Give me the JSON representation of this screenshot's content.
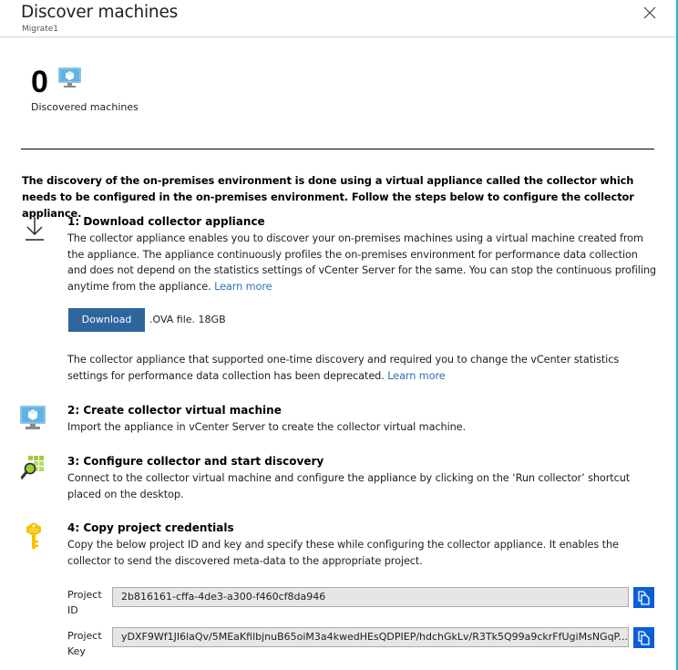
{
  "header": {
    "title": "Discover machines",
    "subtitle": "Migrate1",
    "close_icon": "close-icon"
  },
  "summary": {
    "count": "0",
    "icon": "virtual-machine-icon",
    "label": "Discovered machines"
  },
  "intro": "The discovery of the on-premises environment is done using a virtual appliance called the collector which needs to be configured in the on-premises environment. Follow the steps below to configure the collector appliance.",
  "steps": [
    {
      "icon": "download-icon",
      "title": "1: Download collector appliance",
      "body": "The collector appliance enables you to discover your on-premises machines using a virtual machine created from the appliance. The appliance continuously profiles the on-premises environment for performance data collection and does not depend on the statistics settings of vCenter Server for the same. You can stop the continuous profiling anytime from the appliance.",
      "link": "Learn more",
      "download_label": "Download",
      "download_info": ".OVA file. 18GB",
      "deprecated_text": "The collector appliance that supported one-time discovery and required you to change the vCenter statistics settings for performance data collection has been deprecated.",
      "deprecated_link": "Learn more"
    },
    {
      "icon": "virtual-machine-icon",
      "title": "2: Create collector virtual machine",
      "body": "Import the appliance in vCenter Server to create the collector virtual machine."
    },
    {
      "icon": "discovery-search-icon",
      "title": "3: Configure collector and start discovery",
      "body": "Connect to the collector virtual machine and configure the appliance by clicking on the ‘Run collector’ shortcut placed on the desktop."
    },
    {
      "icon": "key-icon",
      "title": "4: Copy project credentials",
      "body": "Copy the below project ID and key and specify these while configuring the collector appliance. It enables the collector to send the discovered meta-data to the appropriate project."
    }
  ],
  "credentials": {
    "project_id_label": "Project ID",
    "project_id_value": "2b816161-cffa-4de3-a300-f460cf8da946",
    "project_key_label": "Project Key",
    "project_key_value": "yDXF9Wf1JI6laQv/5MEaKfilbjnuB65oiM3a4kwedHEsQDPIEP/hdchGkLv/R3Tk5Q99a9ckrFfUgiMsNGqP...",
    "copy_icon": "copy-icon"
  },
  "colors": {
    "accent_button": "#2f659c",
    "copy_button": "#0a5fd8",
    "link": "#2f6fb7",
    "edge": "#2bb3c0"
  }
}
